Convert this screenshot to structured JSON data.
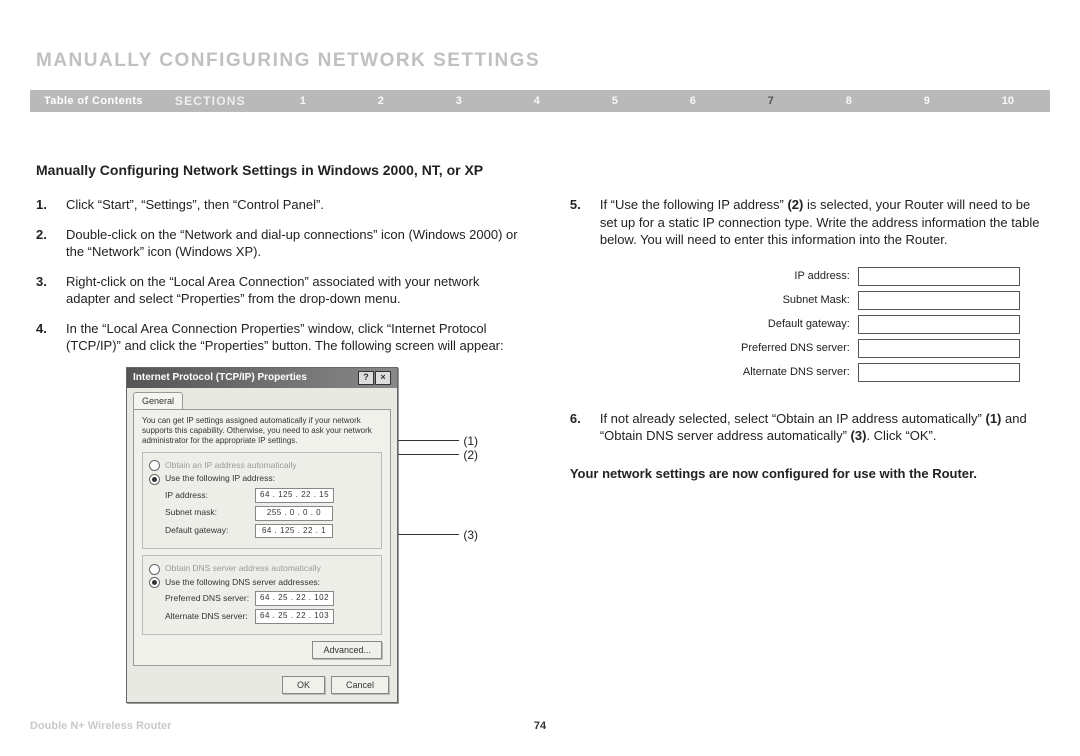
{
  "heading": "MANUALLY CONFIGURING NETWORK SETTINGS",
  "nav": {
    "toc": "Table of Contents",
    "sections_label": "SECTIONS",
    "items": [
      "1",
      "2",
      "3",
      "4",
      "5",
      "6",
      "7",
      "8",
      "9",
      "10"
    ],
    "active_index": 6
  },
  "subheading": "Manually Configuring Network Settings in Windows 2000, NT, or XP",
  "steps_left": [
    {
      "num": "1.",
      "text": "Click “Start”, “Settings”, then “Control Panel”."
    },
    {
      "num": "2.",
      "text": "Double-click on the “Network and dial-up connections” icon (Windows 2000) or the “Network” icon (Windows XP)."
    },
    {
      "num": "3.",
      "text": "Right-click on the “Local Area Connection” associated with your network adapter and select “Properties” from the drop-down menu."
    },
    {
      "num": "4.",
      "text": "In the “Local Area Connection Properties” window, click “Internet Protocol (TCP/IP)” and click the “Properties” button. The following screen will appear:"
    }
  ],
  "dialog": {
    "title": "Internet Protocol (TCP/IP) Properties",
    "tab": "General",
    "desc": "You can get IP settings assigned automatically if your network supports this capability. Otherwise, you need to ask your network administrator for the appropriate IP settings.",
    "radio_auto_ip": "Obtain an IP address automatically",
    "radio_use_ip": "Use the following IP address:",
    "ip_fields": [
      {
        "label": "IP address:",
        "value": "64 . 125 . 22 . 15"
      },
      {
        "label": "Subnet mask:",
        "value": "255 . 0 . 0 . 0"
      },
      {
        "label": "Default gateway:",
        "value": "64 . 125 . 22 . 1"
      }
    ],
    "radio_auto_dns": "Obtain DNS server address automatically",
    "radio_use_dns": "Use the following DNS server addresses:",
    "dns_fields": [
      {
        "label": "Preferred DNS server:",
        "value": "64 . 25 . 22 . 102"
      },
      {
        "label": "Alternate DNS server:",
        "value": "64 . 25 . 22 . 103"
      }
    ],
    "advanced_btn": "Advanced...",
    "ok_btn": "OK",
    "cancel_btn": "Cancel",
    "callouts": [
      "(1)",
      "(2)",
      "(3)"
    ]
  },
  "step5": {
    "num": "5.",
    "pre": "If “Use the following IP address” ",
    "ref": "(2)",
    "post": " is selected, your Router will need to be set up for a static IP connection type. Write the address information the table below. You will need to enter this information into the Router."
  },
  "worksheet_labels": [
    "IP address:",
    "Subnet Mask:",
    "Default gateway:",
    "Preferred DNS server:",
    "Alternate DNS server:"
  ],
  "step6": {
    "num": "6.",
    "pre": "If not already selected, select “Obtain an IP address automatically” ",
    "ref1": "(1)",
    "mid": " and “Obtain DNS server address automatically” ",
    "ref3": "(3)",
    "post": ". Click “OK”."
  },
  "closing": "Your network settings are now configured for use with the Router.",
  "footer_left": "Double N+ Wireless Router",
  "page_number": "74"
}
